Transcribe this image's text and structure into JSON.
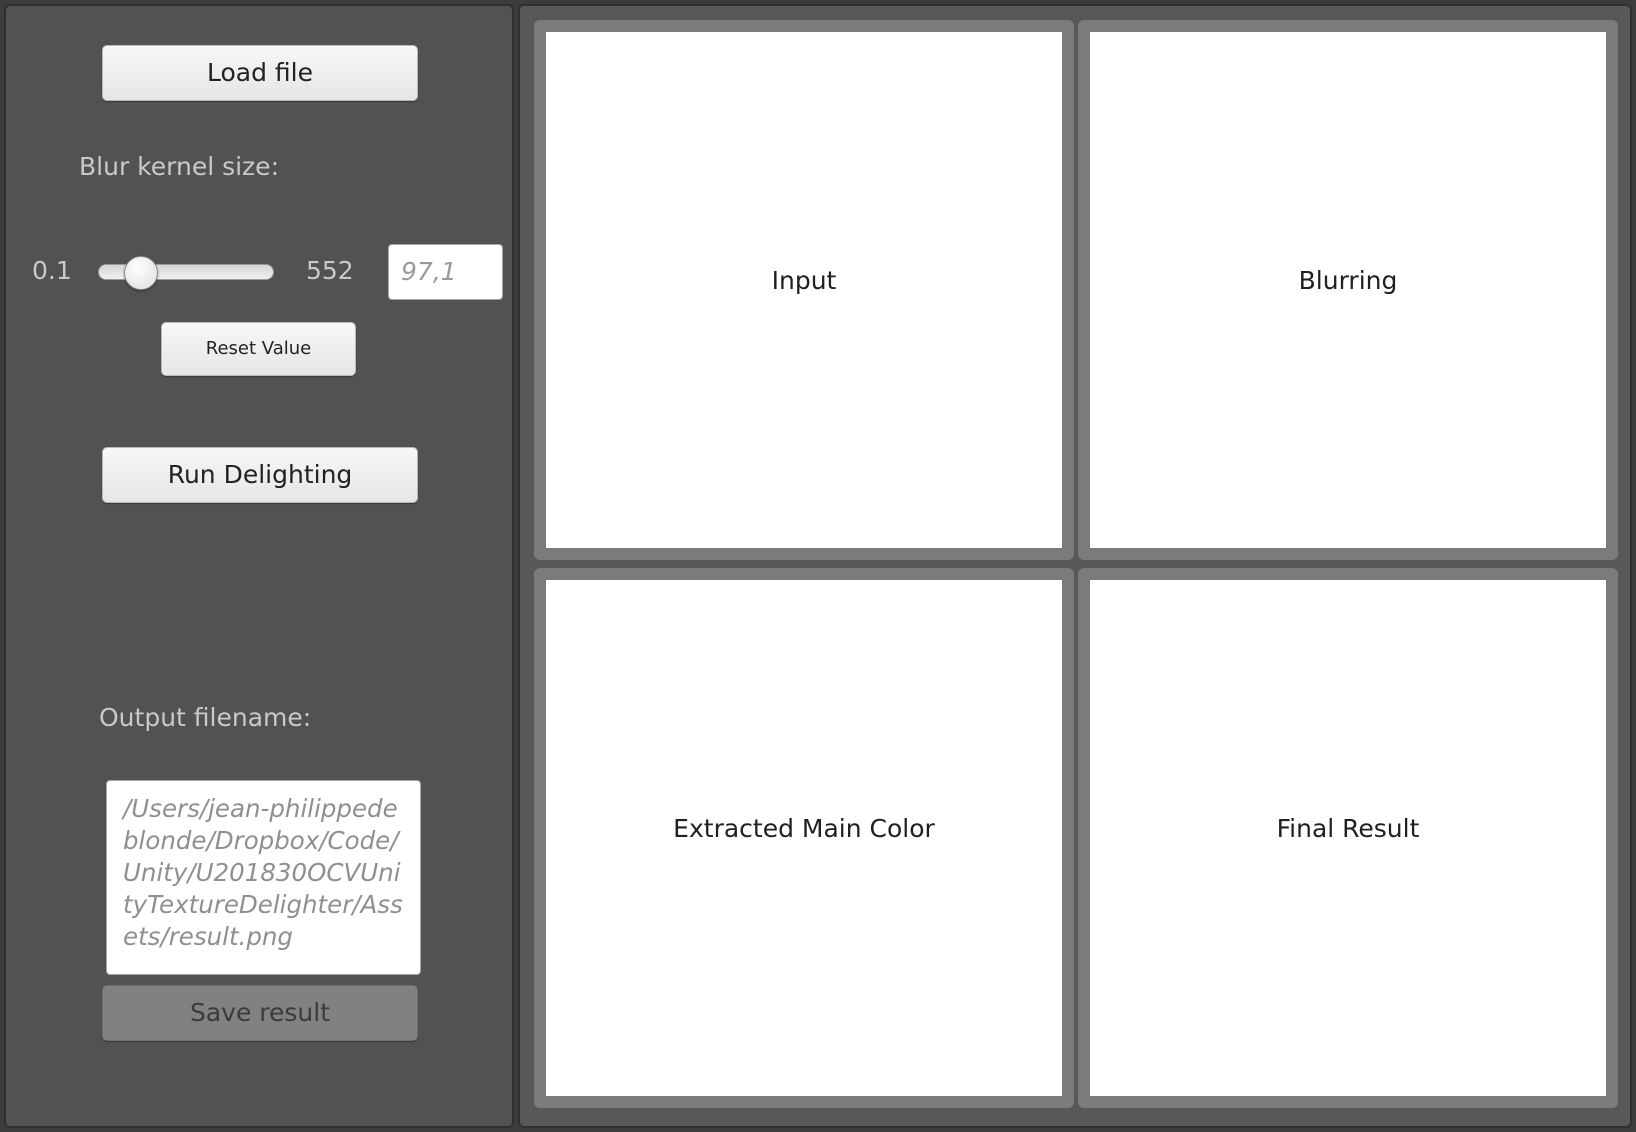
{
  "controls": {
    "load_button": "Load file",
    "blur_label": "Blur kernel size:",
    "slider": {
      "min_label": "0.1",
      "max_label": "552",
      "value_text": "97,1",
      "fraction": 0.18
    },
    "reset_button": "Reset Value",
    "run_button": "Run Delighting",
    "output_label": "Output filename:",
    "output_path": "/Users/jean-philippedeblonde/Dropbox/Code/Unity/U201830OCVUnityTextureDelighter/Assets/result.png",
    "save_button": "Save result"
  },
  "views": [
    {
      "caption": "Input"
    },
    {
      "caption": "Blurring"
    },
    {
      "caption": "Extracted Main Color"
    },
    {
      "caption": "Final Result"
    }
  ],
  "colors": {
    "panel": "#525252",
    "fabric": "#a49a22"
  }
}
